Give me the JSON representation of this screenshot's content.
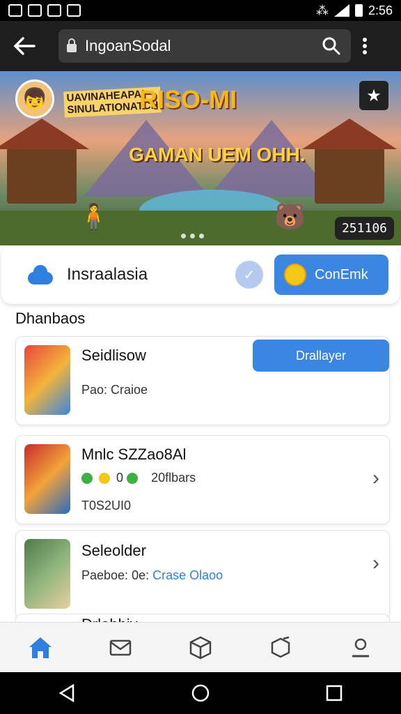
{
  "status_bar": {
    "time": "2:56"
  },
  "browser": {
    "url_text": "IngoanSodal"
  },
  "banner": {
    "badge_text": "UAVINAHEAPAI\nSINULATIONATCH",
    "title": "RISO-MI",
    "subtitle": "GAMAN UEM OHH.",
    "counter": "251106"
  },
  "profile": {
    "name": "Insraalasia",
    "connect_label": "ConEmk"
  },
  "section": {
    "title": "Dhanbaos"
  },
  "cards": [
    {
      "title": "Seidlisow",
      "subtitle": "Pao: Craioe",
      "action_label": "Drallayer"
    },
    {
      "title": "Mnlc SZZao8Al",
      "stats": "0",
      "stats_text": "20flbars",
      "subtitle": "T0S2UI0"
    },
    {
      "title": "Seleolder",
      "subtitle_prefix": "Paeboe:",
      "subtitle_mid": "0e:",
      "subtitle_link": "Crase Olaoo"
    },
    {
      "title": "Drlabbiv"
    }
  ],
  "colors": {
    "accent": "#3a86e2",
    "nav_active": "#2f7fe0"
  }
}
